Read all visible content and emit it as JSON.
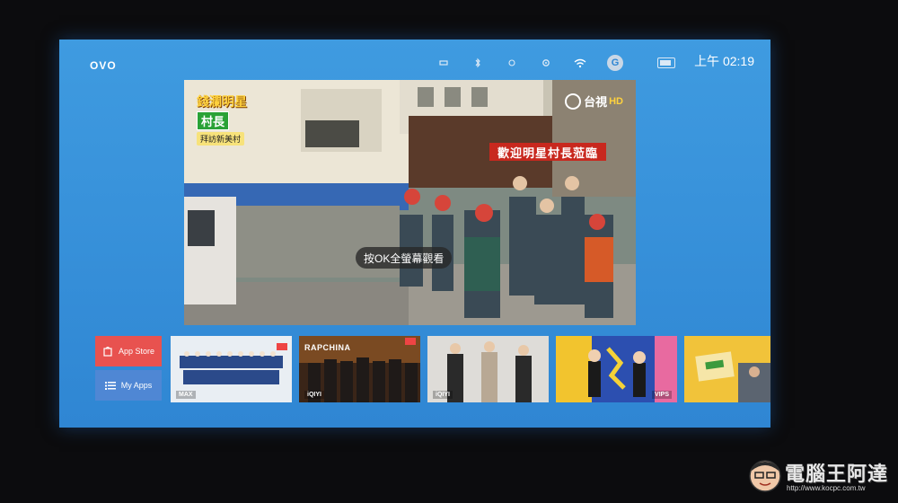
{
  "topbar": {
    "logo": "OVO",
    "clock": "上午 02:19",
    "account_initial": "G",
    "status_icons": [
      "usb-icon",
      "bluetooth-icon",
      "audio-icon",
      "settings-icon",
      "wifi-icon",
      "account-icon",
      "battery-icon"
    ]
  },
  "player": {
    "hint": "按OK全螢幕觀看",
    "show_logo": {
      "line1": "錢瀾明星",
      "line2": "村長",
      "line3": "拜訪新美村"
    },
    "channel": {
      "name": "台視",
      "quality": "HD"
    },
    "banner": "歡迎明星村長蒞臨"
  },
  "apps": {
    "app_store_label": "App Store",
    "my_apps_label": "My Apps"
  },
  "thumbnails": [
    {
      "title": "",
      "badge": "MAX"
    },
    {
      "title": "RAPCHINA",
      "badge": "iQIYI"
    },
    {
      "title": "",
      "badge": "iQIYI"
    },
    {
      "title": "",
      "badge": "VIPS"
    },
    {
      "title": "",
      "badge": ""
    }
  ],
  "watermark": {
    "text": "電腦王阿達",
    "url": "http://www.kocpc.com.tw"
  },
  "colors": {
    "screen": "#3f9be0",
    "app_store": "#e8524f",
    "my_apps": "#4f87d4"
  }
}
